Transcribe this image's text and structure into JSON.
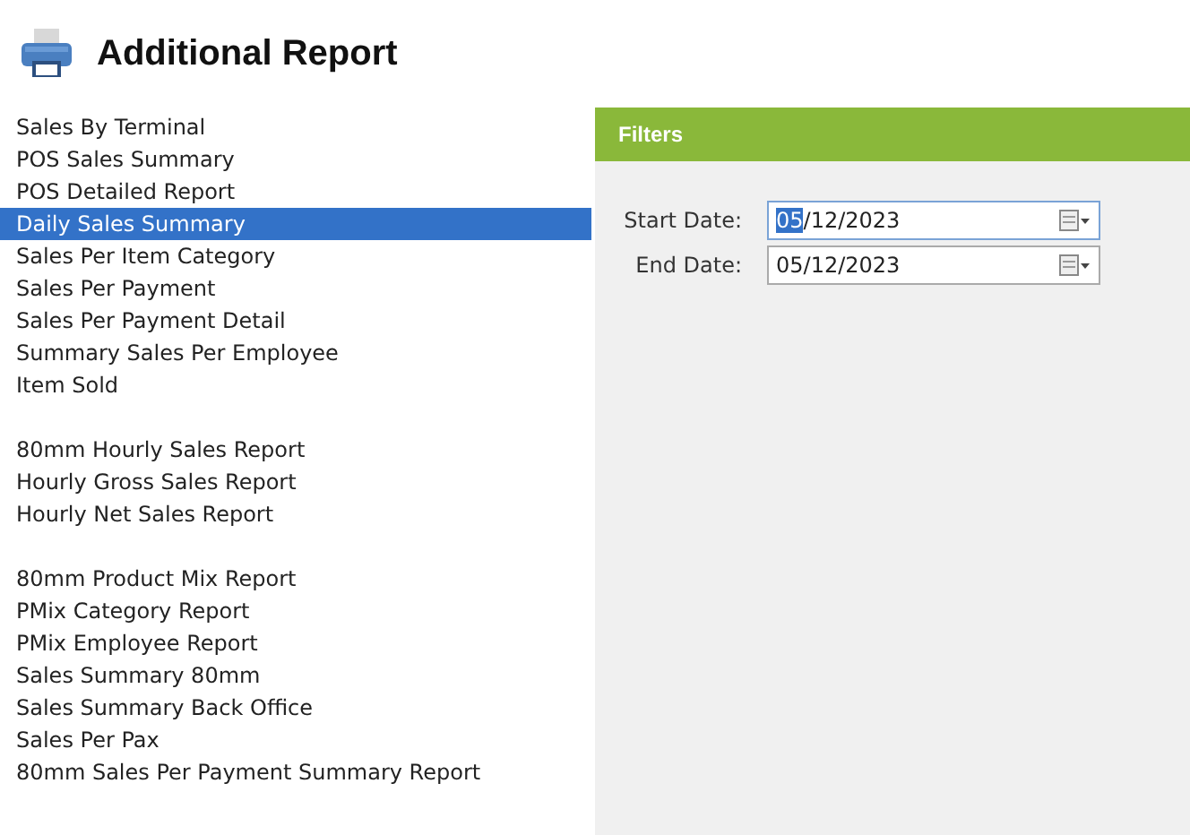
{
  "title": "Additional Report",
  "report_groups": [
    {
      "items": [
        {
          "label": "Sales By Terminal",
          "selected": false
        },
        {
          "label": "POS Sales Summary",
          "selected": false
        },
        {
          "label": "POS Detailed Report",
          "selected": false
        },
        {
          "label": "Daily Sales Summary",
          "selected": true
        },
        {
          "label": "Sales Per Item Category",
          "selected": false
        },
        {
          "label": "Sales Per Payment",
          "selected": false
        },
        {
          "label": "Sales Per Payment Detail",
          "selected": false
        },
        {
          "label": "Summary Sales Per Employee",
          "selected": false
        },
        {
          "label": "Item Sold",
          "selected": false
        }
      ]
    },
    {
      "items": [
        {
          "label": "80mm Hourly Sales Report",
          "selected": false
        },
        {
          "label": "Hourly Gross Sales Report",
          "selected": false
        },
        {
          "label": "Hourly Net Sales Report",
          "selected": false
        }
      ]
    },
    {
      "items": [
        {
          "label": "80mm Product Mix Report",
          "selected": false
        },
        {
          "label": "PMix Category Report",
          "selected": false
        },
        {
          "label": "PMix Employee Report",
          "selected": false
        },
        {
          "label": "Sales Summary 80mm",
          "selected": false
        },
        {
          "label": "Sales Summary Back Office",
          "selected": false
        },
        {
          "label": "Sales Per Pax",
          "selected": false
        },
        {
          "label": "80mm Sales Per Payment Summary Report",
          "selected": false
        }
      ]
    }
  ],
  "filters": {
    "title": "Filters",
    "fields": [
      {
        "label": "Start Date:",
        "value": "05/12/2023",
        "focused": true
      },
      {
        "label": "End Date:",
        "value": "05/12/2023",
        "focused": false
      }
    ]
  }
}
